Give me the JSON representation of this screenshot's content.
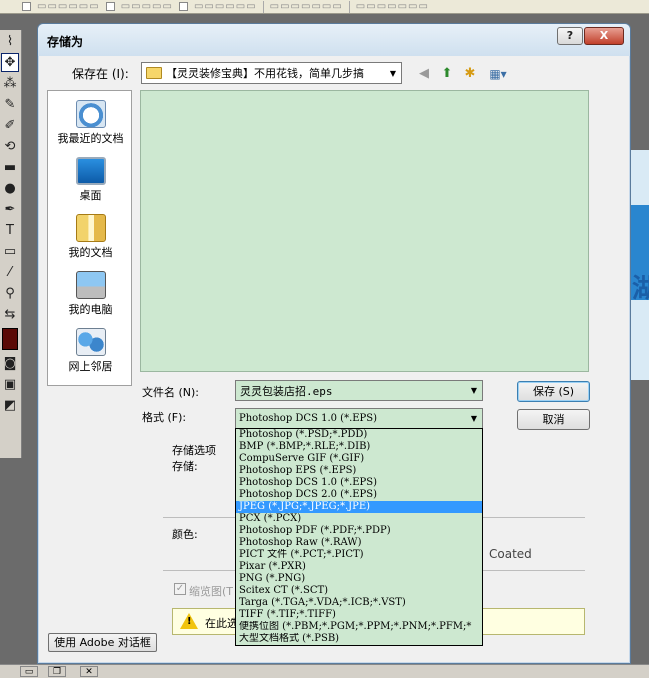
{
  "dialog": {
    "title": "存储为",
    "help_label": "?",
    "close_label": "X"
  },
  "save_in": {
    "label": "保存在 (I):",
    "value": "【灵灵装修宝典】不用花钱，简单几步搞"
  },
  "places": [
    {
      "label": "我最近的文档",
      "icon": "recent-documents-icon"
    },
    {
      "label": "桌面",
      "icon": "desktop-icon"
    },
    {
      "label": "我的文档",
      "icon": "my-documents-icon"
    },
    {
      "label": "我的电脑",
      "icon": "my-computer-icon"
    },
    {
      "label": "网上邻居",
      "icon": "network-places-icon"
    }
  ],
  "filename": {
    "label": "文件名 (N):",
    "value": "灵灵包装店招.eps"
  },
  "format": {
    "label": "格式 (F):",
    "value": "Photoshop DCS 1.0 (*.EPS)",
    "options": [
      "Photoshop (*.PSD;*.PDD)",
      "BMP (*.BMP;*.RLE;*.DIB)",
      "CompuServe GIF (*.GIF)",
      "Photoshop EPS (*.EPS)",
      "Photoshop DCS 1.0 (*.EPS)",
      "Photoshop DCS 2.0 (*.EPS)",
      "JPEG (*.JPG;*.JPEG;*.JPE)",
      "PCX (*.PCX)",
      "Photoshop PDF (*.PDF;*.PDP)",
      "Photoshop Raw (*.RAW)",
      "PICT 文件 (*.PCT;*.PICT)",
      "Pixar (*.PXR)",
      "PNG (*.PNG)",
      "Scitex CT (*.SCT)",
      "Targa (*.TGA;*.VDA;*.ICB;*.VST)",
      "TIFF (*.TIF;*.TIFF)",
      "便携位图 (*.PBM;*.PGM;*.PPM;*.PNM;*.PFM;*",
      "大型文档格式 (*.PSB)"
    ],
    "highlighted_option": "JPEG (*.JPG;*.JPEG;*.JPE)"
  },
  "buttons": {
    "save": "保存 (S)",
    "cancel": "取消",
    "adobe_dialog": "使用 Adobe 对话框"
  },
  "options": {
    "title": "存储选项",
    "save_label": "存储:",
    "color_label": "颜色:",
    "profile_suffix": "Coated",
    "thumbnail_label": "缩览图(T",
    "thumbnail_checked": true,
    "warning_text": "在此选"
  },
  "colors": {
    "list_background": "#cde8d0",
    "selection": "#3399ff",
    "dialog_background": "#f0f0f0"
  }
}
